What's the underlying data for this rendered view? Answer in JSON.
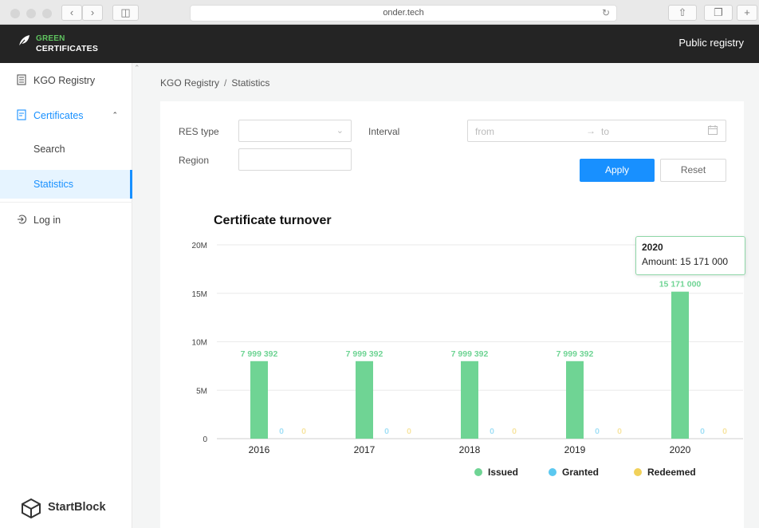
{
  "browser": {
    "url": "onder.tech",
    "icons": [
      "back-icon",
      "forward-icon",
      "sidebar-toggle-icon",
      "reload-icon",
      "share-icon",
      "tabs-icon",
      "new-tab-icon"
    ]
  },
  "header": {
    "logo_line1": "GREEN",
    "logo_line2": "CERTIFICATES",
    "public_registry": "Public registry"
  },
  "sidebar": {
    "items": [
      {
        "label": "KGO Registry",
        "icon": "registry-icon"
      },
      {
        "label": "Certificates",
        "icon": "certificate-icon"
      },
      {
        "label": "Search"
      },
      {
        "label": "Statistics"
      },
      {
        "label": "Log in",
        "icon": "login-icon"
      }
    ],
    "brand": "StartBlock"
  },
  "breadcrumb": {
    "root": "KGO Registry",
    "separator": "/",
    "current": "Statistics"
  },
  "filters": {
    "res_type_label": "RES type",
    "res_type_value": "",
    "interval_label": "Interval",
    "from_placeholder": "from",
    "to_placeholder": "to",
    "region_label": "Region",
    "region_value": "",
    "apply_label": "Apply",
    "reset_label": "Reset"
  },
  "chart_title": "Certificate turnover",
  "tooltip": {
    "title": "2020",
    "text": "Amount: 15 171 000"
  },
  "colors": {
    "issued": "#6fd494",
    "granted": "#5bc8f0",
    "redeemed": "#f1d15a",
    "accent": "#1890ff"
  },
  "chart_data": {
    "type": "bar",
    "title": "Certificate turnover",
    "categories": [
      "2016",
      "2017",
      "2018",
      "2019",
      "2020"
    ],
    "y_ticks": [
      "0",
      "5M",
      "10M",
      "15M",
      "20M"
    ],
    "ylim": [
      0,
      20000000
    ],
    "grid": true,
    "legend_position": "bottom",
    "series": [
      {
        "name": "Issued",
        "values": [
          7999392,
          7999392,
          7999392,
          7999392,
          15171000
        ],
        "labels": [
          "7 999 392",
          "7 999 392",
          "7 999 392",
          "7 999 392",
          "15 171 000"
        ]
      },
      {
        "name": "Granted",
        "values": [
          0,
          0,
          0,
          0,
          0
        ],
        "labels": [
          "0",
          "0",
          "0",
          "0",
          "0"
        ]
      },
      {
        "name": "Redeemed",
        "values": [
          0,
          0,
          0,
          0,
          0
        ],
        "labels": [
          "0",
          "0",
          "0",
          "0",
          "0"
        ]
      }
    ]
  }
}
